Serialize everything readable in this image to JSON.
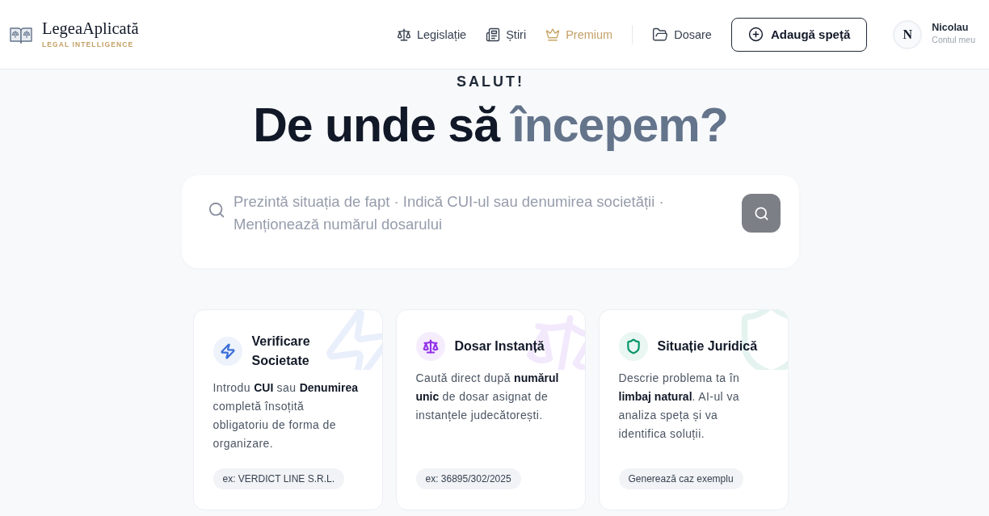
{
  "brand": {
    "name": "LegeaAplicată",
    "tagline": "LEGAL INTELLIGENCE"
  },
  "nav": {
    "links": [
      {
        "label": "Legislație",
        "kind": "link"
      },
      {
        "label": "Știri",
        "kind": "link"
      },
      {
        "label": "Premium",
        "kind": "premium"
      }
    ],
    "folders_link": {
      "label": "Dosare"
    },
    "add_button": {
      "label": "Adaugă speță"
    }
  },
  "user": {
    "initial": "N",
    "name": "Nicolau",
    "subtitle": "Contul meu"
  },
  "greeting": "SALUT!",
  "heading": {
    "text": "De unde să",
    "accent": "începem?"
  },
  "search": {
    "placeholder": "Prezintă situația de fapt · Indică CUI-ul sau denumirea societății · Menționează numărul dosarului"
  },
  "cards": [
    {
      "title": "Verificare Societate",
      "color": "#3b6fd8",
      "description": "Introdu **CUI** sau **Denumirea** completă însoțită obligatoriu de forma de organizare.",
      "example": "ex: VERDICT LINE S.R.L."
    },
    {
      "title": "Dosar Instanță",
      "color": "#9333ea",
      "description": "Caută direct după **numărul unic** de dosar asignat de instanțele judecătorești.",
      "example": "ex: 36895/302/2025"
    },
    {
      "title": "Situație Juridică",
      "color": "#059669",
      "description": "Descrie problema ta în **limbaj natural**. AI-ul va analiza speța și va identifica soluții.",
      "example": "Generează caz exemplu"
    }
  ]
}
